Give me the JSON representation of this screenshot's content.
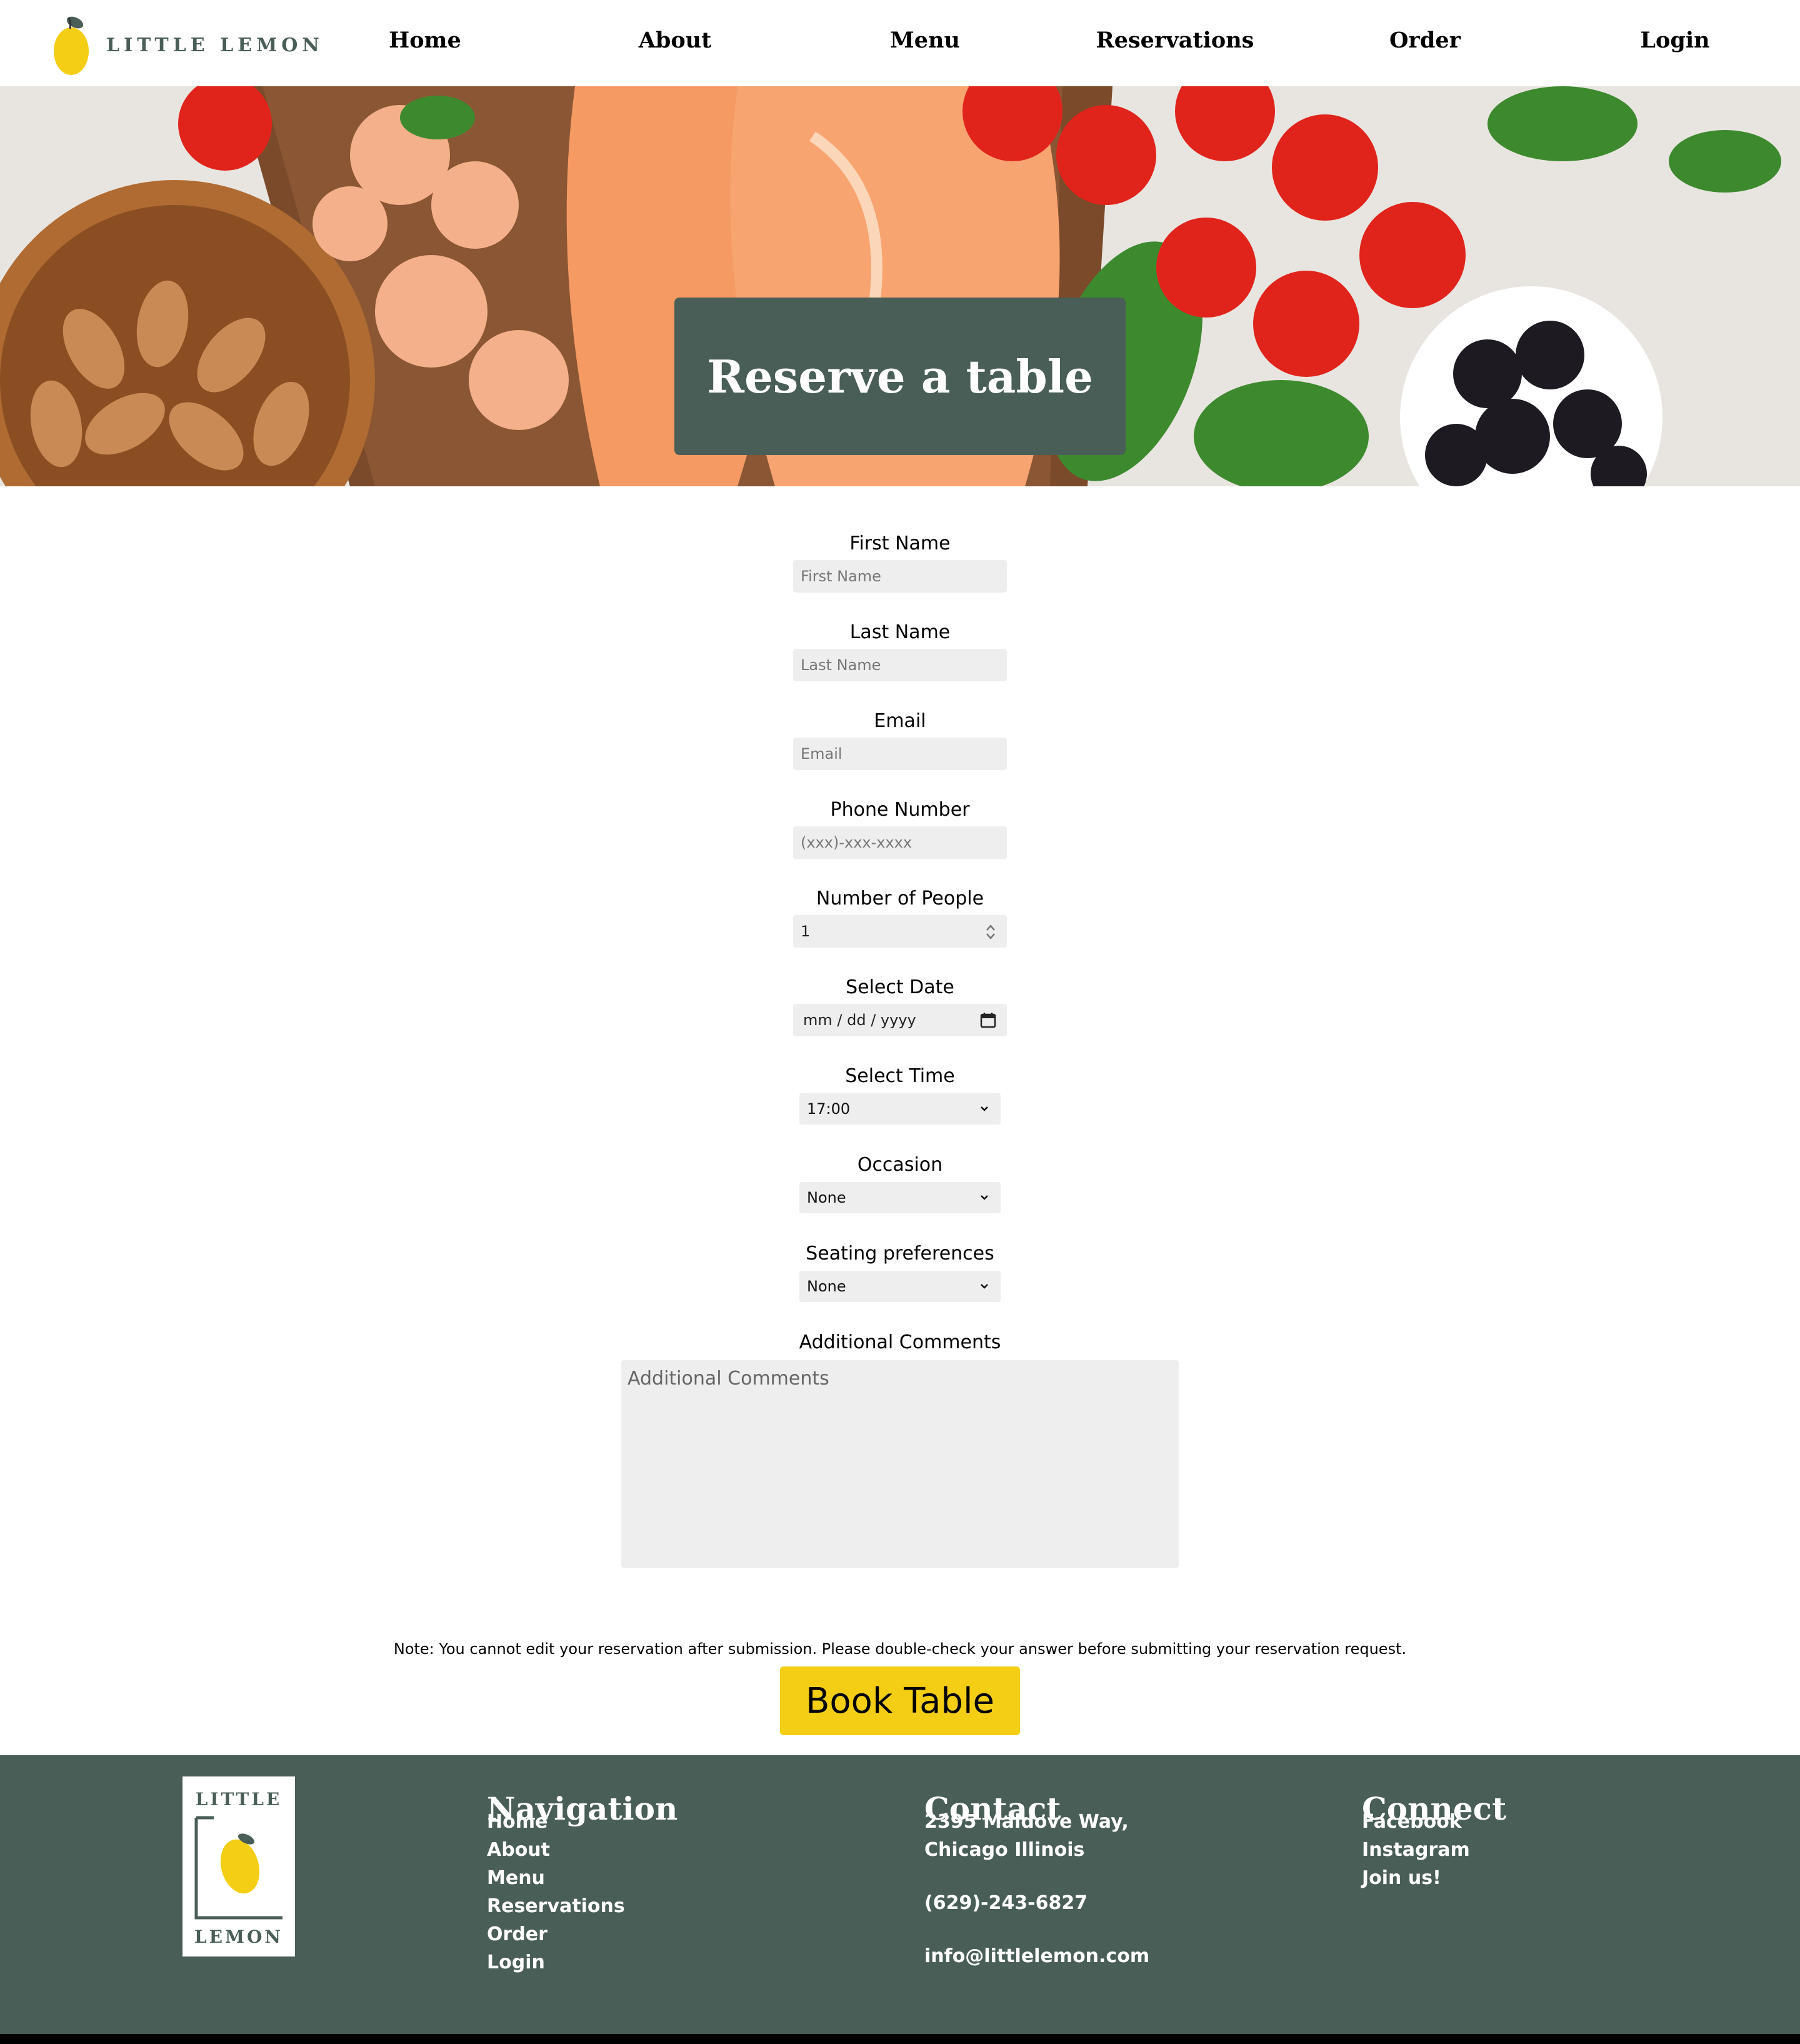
{
  "brand": {
    "name": "LITTLE LEMON"
  },
  "nav": {
    "items": [
      {
        "label": "Home"
      },
      {
        "label": "About"
      },
      {
        "label": "Menu"
      },
      {
        "label": "Reservations"
      },
      {
        "label": "Order"
      },
      {
        "label": "Login"
      }
    ]
  },
  "hero": {
    "title": "Reserve a table"
  },
  "form": {
    "first_name": {
      "label": "First Name",
      "placeholder": "First Name"
    },
    "last_name": {
      "label": "Last Name",
      "placeholder": "Last Name"
    },
    "email": {
      "label": "Email",
      "placeholder": "Email"
    },
    "phone": {
      "label": "Phone Number",
      "placeholder": "(xxx)-xxx-xxxx"
    },
    "people": {
      "label": "Number of People",
      "value": "1"
    },
    "date": {
      "label": "Select Date",
      "placeholder": "mm / dd / yyyy"
    },
    "time": {
      "label": "Select Time",
      "value": "17:00"
    },
    "occasion": {
      "label": "Occasion",
      "value": "None"
    },
    "seating": {
      "label": "Seating preferences",
      "value": "None"
    },
    "comments": {
      "label": "Additional Comments",
      "placeholder": "Additional Comments"
    },
    "note": "Note: You cannot edit your reservation after submission. Please double-check your answer before submitting your reservation request.",
    "submit_label": "Book Table"
  },
  "footer": {
    "logo_top": "LITTLE",
    "logo_bottom": "LEMON",
    "navigation": {
      "heading": "Navigation",
      "items": [
        "Home",
        "About",
        "Menu",
        "Reservations",
        "Order",
        "Login"
      ]
    },
    "contact": {
      "heading": "Contact",
      "address_line1": "2395 Maldove Way,",
      "address_line2": "Chicago Illinois",
      "phone": "(629)-243-6827",
      "email": "info@littlelemon.com"
    },
    "connect": {
      "heading": "Connect",
      "items": [
        "Facebook",
        "Instagram",
        "Join us!"
      ]
    }
  },
  "colors": {
    "primary_green": "#495e57",
    "accent_yellow": "#f4ce14",
    "field_gray": "#eeeeee"
  }
}
